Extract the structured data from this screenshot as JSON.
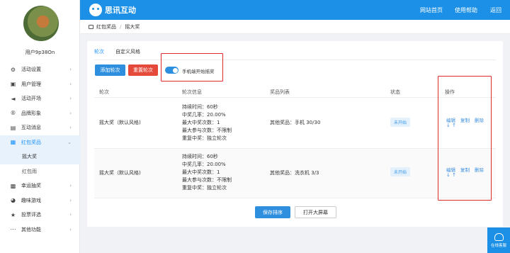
{
  "user": {
    "name": "用户9p38On"
  },
  "sidebar": {
    "items": [
      {
        "label": "活动设置",
        "icon": "gear-icon"
      },
      {
        "label": "用户管理",
        "icon": "user-icon"
      },
      {
        "label": "活动开场",
        "icon": "megaphone-icon"
      },
      {
        "label": "品牌形象",
        "icon": "brand-icon"
      },
      {
        "label": "互动消息",
        "icon": "chat-icon"
      },
      {
        "label": "红包奖品",
        "icon": "gift-icon"
      },
      {
        "label": "摇大奖",
        "sub": true
      },
      {
        "label": "红包雨",
        "sub": true
      },
      {
        "label": "幸运抽奖",
        "icon": "grid-icon"
      },
      {
        "label": "趣味游戏",
        "icon": "game-icon"
      },
      {
        "label": "投票评选",
        "icon": "star-icon"
      },
      {
        "label": "其他功能",
        "icon": "more-icon"
      }
    ]
  },
  "header": {
    "brand": "思讯互动",
    "nav": [
      "网站首页",
      "使用帮助",
      "返回"
    ]
  },
  "breadcrumb": [
    "红包奖品",
    "/",
    "摇大奖"
  ],
  "tabs": [
    "轮次",
    "自定义风格"
  ],
  "toolbar": {
    "add_round": "添加轮次",
    "reset_round": "重置轮次",
    "toggle_label": "手机端开始摇奖",
    "toggle_on": true
  },
  "table": {
    "headers": [
      "轮次",
      "轮次信息",
      "奖品列表",
      "状态",
      "操作"
    ],
    "rows": [
      {
        "name": "摇大奖（默认风格)",
        "info": [
          "持续时间：60秒",
          "中奖几率：20.00%",
          "最大中奖次数：1",
          "最大参与次数：不限制",
          "重复中奖：独立轮次"
        ],
        "prizes": "其他奖品：手机 30/30",
        "status": "未开始",
        "ops": [
          "编辑",
          "复制",
          "删除"
        ],
        "arrows": "↓ ↑"
      },
      {
        "name": "摇大奖（默认风格)",
        "info": [
          "持续时间：60秒",
          "中奖几率：20.00%",
          "最大中奖次数：1",
          "最大参与次数：不限制",
          "重复中奖：独立轮次"
        ],
        "prizes": "其他奖品：洗衣机 3/3",
        "status": "未开始",
        "ops": [
          "编辑",
          "复制",
          "删除"
        ],
        "arrows": "↓ ↑"
      }
    ]
  },
  "footer": {
    "save": "保存排序",
    "open_screen": "打开大屏幕"
  },
  "service": {
    "label": "在线客服"
  },
  "colors": {
    "primary": "#1b90e6",
    "danger": "#e5493a",
    "annotation": "#e02b2b"
  }
}
